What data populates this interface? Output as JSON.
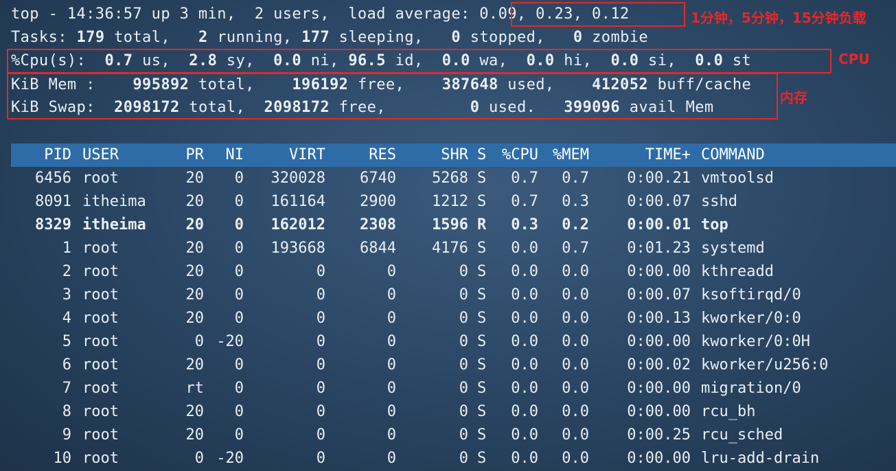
{
  "summary": {
    "uptime_line_prefix": "top - 14:36:57 up 3 min,  2 users,  load average:",
    "load_average": "0.09, 0.23, 0.12",
    "tasks": {
      "label": "Tasks:",
      "total": "179",
      "total_label": "total,",
      "running": "2",
      "running_label": "running,",
      "sleeping": "177",
      "sleeping_label": "sleeping,",
      "stopped": "0",
      "stopped_label": "stopped,",
      "zombie": "0",
      "zombie_label": "zombie"
    },
    "cpu": {
      "label": "%Cpu(s):",
      "us": "0.7",
      "us_label": "us,",
      "sy": "2.8",
      "sy_label": "sy,",
      "ni": "0.0",
      "ni_label": "ni,",
      "id": "96.5",
      "id_label": "id,",
      "wa": "0.0",
      "wa_label": "wa,",
      "hi": "0.0",
      "hi_label": "hi,",
      "si": "0.0",
      "si_label": "si,",
      "st": "0.0",
      "st_label": "st"
    },
    "mem": {
      "label": "KiB Mem :",
      "total": "995892",
      "total_label": "total,",
      "free": "196192",
      "free_label": "free,",
      "used": "387648",
      "used_label": "used,",
      "buff": "412052",
      "buff_label": "buff/cache"
    },
    "swap": {
      "label": "KiB Swap:",
      "total": "2098172",
      "total_label": "total,",
      "free": "2098172",
      "free_label": "free,",
      "used": "0",
      "used_label": "used.",
      "avail": "399096",
      "avail_label": "avail Mem"
    }
  },
  "annotations": {
    "load": "1分钟，5分钟，15分钟负载",
    "cpu": "CPU",
    "mem": "内存",
    "color": "#e02a2a"
  },
  "table": {
    "header_color": "#2e6ca8",
    "columns": [
      "PID",
      "USER",
      "PR",
      "NI",
      "VIRT",
      "RES",
      "SHR",
      "S",
      "%CPU",
      "%MEM",
      "TIME+",
      "COMMAND"
    ],
    "rows": [
      {
        "pid": "6456",
        "user": "root",
        "pr": "20",
        "ni": "0",
        "virt": "320028",
        "res": "6740",
        "shr": "5268",
        "s": "S",
        "cpu": "0.7",
        "mem": "0.7",
        "time": "0:00.21",
        "cmd": "vmtoolsd"
      },
      {
        "pid": "8091",
        "user": "itheima",
        "pr": "20",
        "ni": "0",
        "virt": "161164",
        "res": "2900",
        "shr": "1212",
        "s": "S",
        "cpu": "0.7",
        "mem": "0.3",
        "time": "0:00.07",
        "cmd": "sshd"
      },
      {
        "pid": "8329",
        "user": "itheima",
        "pr": "20",
        "ni": "0",
        "virt": "162012",
        "res": "2308",
        "shr": "1596",
        "s": "R",
        "cpu": "0.3",
        "mem": "0.2",
        "time": "0:00.01",
        "cmd": "top"
      },
      {
        "pid": "1",
        "user": "root",
        "pr": "20",
        "ni": "0",
        "virt": "193668",
        "res": "6844",
        "shr": "4176",
        "s": "S",
        "cpu": "0.0",
        "mem": "0.7",
        "time": "0:01.23",
        "cmd": "systemd"
      },
      {
        "pid": "2",
        "user": "root",
        "pr": "20",
        "ni": "0",
        "virt": "0",
        "res": "0",
        "shr": "0",
        "s": "S",
        "cpu": "0.0",
        "mem": "0.0",
        "time": "0:00.00",
        "cmd": "kthreadd"
      },
      {
        "pid": "3",
        "user": "root",
        "pr": "20",
        "ni": "0",
        "virt": "0",
        "res": "0",
        "shr": "0",
        "s": "S",
        "cpu": "0.0",
        "mem": "0.0",
        "time": "0:00.07",
        "cmd": "ksoftirqd/0"
      },
      {
        "pid": "4",
        "user": "root",
        "pr": "20",
        "ni": "0",
        "virt": "0",
        "res": "0",
        "shr": "0",
        "s": "S",
        "cpu": "0.0",
        "mem": "0.0",
        "time": "0:00.13",
        "cmd": "kworker/0:0"
      },
      {
        "pid": "5",
        "user": "root",
        "pr": "0",
        "ni": "-20",
        "virt": "0",
        "res": "0",
        "shr": "0",
        "s": "S",
        "cpu": "0.0",
        "mem": "0.0",
        "time": "0:00.00",
        "cmd": "kworker/0:0H"
      },
      {
        "pid": "6",
        "user": "root",
        "pr": "20",
        "ni": "0",
        "virt": "0",
        "res": "0",
        "shr": "0",
        "s": "S",
        "cpu": "0.0",
        "mem": "0.0",
        "time": "0:00.02",
        "cmd": "kworker/u256:0"
      },
      {
        "pid": "7",
        "user": "root",
        "pr": "rt",
        "ni": "0",
        "virt": "0",
        "res": "0",
        "shr": "0",
        "s": "S",
        "cpu": "0.0",
        "mem": "0.0",
        "time": "0:00.00",
        "cmd": "migration/0"
      },
      {
        "pid": "8",
        "user": "root",
        "pr": "20",
        "ni": "0",
        "virt": "0",
        "res": "0",
        "shr": "0",
        "s": "S",
        "cpu": "0.0",
        "mem": "0.0",
        "time": "0:00.00",
        "cmd": "rcu_bh"
      },
      {
        "pid": "9",
        "user": "root",
        "pr": "20",
        "ni": "0",
        "virt": "0",
        "res": "0",
        "shr": "0",
        "s": "S",
        "cpu": "0.0",
        "mem": "0.0",
        "time": "0:00.25",
        "cmd": "rcu_sched"
      },
      {
        "pid": "10",
        "user": "root",
        "pr": "0",
        "ni": "-20",
        "virt": "0",
        "res": "0",
        "shr": "0",
        "s": "S",
        "cpu": "0.0",
        "mem": "0.0",
        "time": "0:00.00",
        "cmd": "lru-add-drain"
      }
    ]
  }
}
